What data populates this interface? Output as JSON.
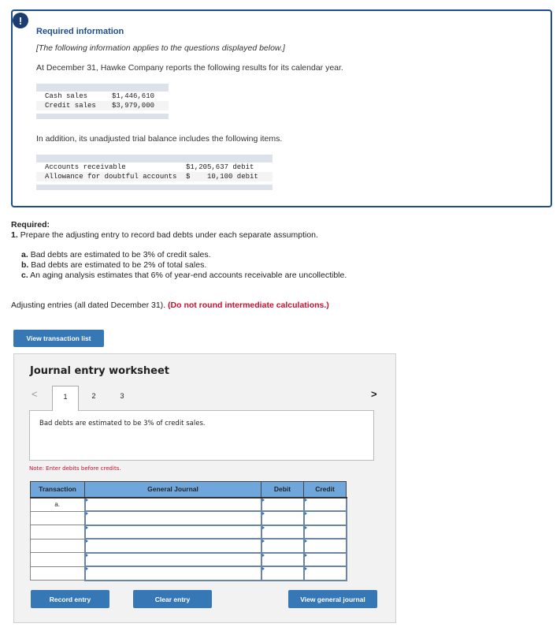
{
  "info": {
    "alert_icon": "!",
    "title": "Required information",
    "intro": "[The following information applies to the questions displayed below.]",
    "statement": "At December 31, Hawke Company reports the following results for its calendar year.",
    "sales_table": [
      {
        "label": "Cash sales",
        "value": "$1,446,610"
      },
      {
        "label": "Credit sales",
        "value": "$3,979,000"
      }
    ],
    "trial_balance_intro": "In addition, its unadjusted trial balance includes the following items.",
    "trial_balance_table": [
      {
        "label": "Accounts receivable",
        "value": "$1,205,637 debit"
      },
      {
        "label": "Allowance for doubtful accounts",
        "value": "$    10,100 debit"
      }
    ]
  },
  "required": {
    "heading": "Required:",
    "item_number": "1.",
    "item_text": "Prepare the adjusting entry to record bad debts under each separate assumption.",
    "parts": [
      {
        "letter": "a.",
        "text": "Bad debts are estimated to be 3% of credit sales."
      },
      {
        "letter": "b.",
        "text": "Bad debts are estimated to be 2% of total sales."
      },
      {
        "letter": "c.",
        "text": "An aging analysis estimates that 6% of year-end accounts receivable are uncollectible."
      }
    ],
    "adjusting_text": "Adjusting entries (all dated December 31).",
    "adjusting_warning": "(Do not round intermediate calculations.)"
  },
  "buttons": {
    "view_transaction_list": "View transaction list",
    "record_entry": "Record entry",
    "clear_entry": "Clear entry",
    "view_general_journal": "View general journal"
  },
  "worksheet": {
    "title": "Journal entry worksheet",
    "prev_icon": "<",
    "next_icon": ">",
    "tabs": [
      "1",
      "2",
      "3"
    ],
    "active_tab": "1",
    "description": "Bad debts are estimated to be 3% of credit sales.",
    "note": "Note: Enter debits before credits.",
    "columns": [
      "Transaction",
      "General Journal",
      "Debit",
      "Credit"
    ],
    "rows": [
      {
        "transaction": "a.",
        "account": "",
        "debit": "",
        "credit": ""
      },
      {
        "transaction": "",
        "account": "",
        "debit": "",
        "credit": ""
      },
      {
        "transaction": "",
        "account": "",
        "debit": "",
        "credit": ""
      },
      {
        "transaction": "",
        "account": "",
        "debit": "",
        "credit": ""
      },
      {
        "transaction": "",
        "account": "",
        "debit": "",
        "credit": ""
      },
      {
        "transaction": "",
        "account": "",
        "debit": "",
        "credit": ""
      }
    ]
  }
}
